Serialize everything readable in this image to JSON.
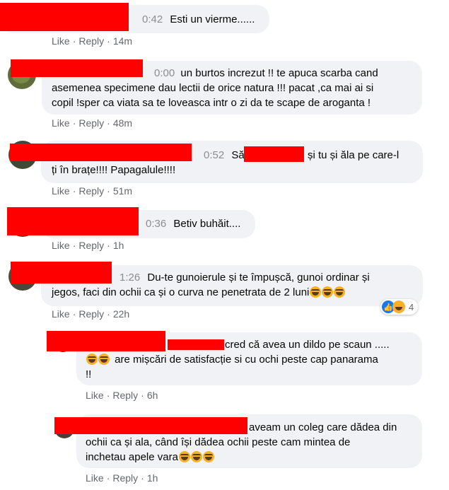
{
  "comments": [
    {
      "time": "0:42",
      "lines": [
        "Esti un vierme......"
      ],
      "like": "Like",
      "reply": "Reply",
      "age": "14m"
    },
    {
      "time": "0:00",
      "lines": [
        "un burtos increzut !! te apuca scarba cand",
        "asemenea specimene dau lectii de orice natura !!! pacat ,ca mai ai si",
        "copil !sper ca viata sa te loveasca intr o zi da te scape de aroganta !"
      ],
      "like": "Like",
      "reply": "Reply",
      "age": "48m"
    },
    {
      "time": "0:52",
      "line1_start": "Să",
      "line1_end": "și tu și ăla pe care-l",
      "line2": "ți în brațe!!!! Papagalule!!!!",
      "like": "Like",
      "reply": "Reply",
      "age": "51m"
    },
    {
      "time": "0:36",
      "lines": [
        "Betiv buhăit...."
      ],
      "like": "Like",
      "reply": "Reply",
      "age": "1h"
    },
    {
      "time": "1:26",
      "line1": "Du-te gunoierule și te împușcă, gunoi ordinar și",
      "line2": "jegos, faci din ochii ca și o curva ne penetrata de 2 luni",
      "like": "Like",
      "reply": "Reply",
      "age": "22h",
      "reaction_count": "4"
    }
  ],
  "replies": [
    {
      "line1": "cred că avea un dildo pe scaun .....",
      "line2": "are mișcări de satisfacție si cu ochi peste cap panarama",
      "line3": "!!",
      "like": "Like",
      "reply": "Reply",
      "age": "6h"
    },
    {
      "line1": "aveam un coleg care dădea din",
      "line2": "ochii ca și ala, când își dădea ochii peste cam mintea de",
      "line3": "inchetau apele vara",
      "like": "Like",
      "reply": "Reply",
      "age": "1h"
    }
  ],
  "separator": "·",
  "icons": {
    "emoji": "laughing-crying-emoji-icon",
    "like": "like-reaction-icon",
    "haha": "haha-reaction-icon"
  },
  "colors": {
    "redaction": "#ff0000",
    "bubble": "#f0f2f5",
    "action_text": "#65676b",
    "time_text": "#8a8d91"
  }
}
